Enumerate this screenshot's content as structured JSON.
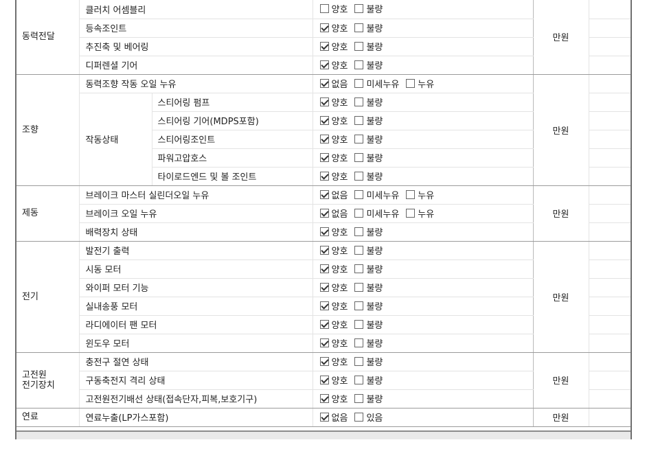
{
  "price_unit": "만원",
  "sections": [
    {
      "category": "동력전달",
      "price": "만원",
      "rows": [
        {
          "item": "클러치 어셈블리",
          "options": [
            {
              "label": "양호",
              "checked": false
            },
            {
              "label": "불량",
              "checked": false
            }
          ]
        },
        {
          "item": "등속조인트",
          "options": [
            {
              "label": "양호",
              "checked": true
            },
            {
              "label": "불량",
              "checked": false
            }
          ]
        },
        {
          "item": "추진축 및 베어링",
          "options": [
            {
              "label": "양호",
              "checked": true
            },
            {
              "label": "불량",
              "checked": false
            }
          ]
        },
        {
          "item": "디퍼렌셜 기어",
          "options": [
            {
              "label": "양호",
              "checked": true
            },
            {
              "label": "불량",
              "checked": false
            }
          ]
        }
      ]
    },
    {
      "category": "조향",
      "price": "만원",
      "rows": [
        {
          "item": "동력조향 작동 오일 누유",
          "options": [
            {
              "label": "없음",
              "checked": true
            },
            {
              "label": "미세누유",
              "checked": false
            },
            {
              "label": "누유",
              "checked": false
            }
          ]
        },
        {
          "item": "작동상태",
          "sub": "스티어링 펌프",
          "options": [
            {
              "label": "양호",
              "checked": true
            },
            {
              "label": "불량",
              "checked": false
            }
          ]
        },
        {
          "item": "작동상태",
          "sub": "스티어링 기어(MDPS포함)",
          "options": [
            {
              "label": "양호",
              "checked": true
            },
            {
              "label": "불량",
              "checked": false
            }
          ]
        },
        {
          "item": "작동상태",
          "sub": "스티어링조인트",
          "options": [
            {
              "label": "양호",
              "checked": true
            },
            {
              "label": "불량",
              "checked": false
            }
          ]
        },
        {
          "item": "작동상태",
          "sub": "파워고압호스",
          "options": [
            {
              "label": "양호",
              "checked": true
            },
            {
              "label": "불량",
              "checked": false
            }
          ]
        },
        {
          "item": "작동상태",
          "sub": "타이로드엔드 및 볼 조인트",
          "options": [
            {
              "label": "양호",
              "checked": true
            },
            {
              "label": "불량",
              "checked": false
            }
          ]
        }
      ]
    },
    {
      "category": "제동",
      "price": "만원",
      "rows": [
        {
          "item": "브레이크 마스터 실린더오일 누유",
          "options": [
            {
              "label": "없음",
              "checked": true
            },
            {
              "label": "미세누유",
              "checked": false
            },
            {
              "label": "누유",
              "checked": false
            }
          ]
        },
        {
          "item": "브레이크 오일 누유",
          "options": [
            {
              "label": "없음",
              "checked": true
            },
            {
              "label": "미세누유",
              "checked": false
            },
            {
              "label": "누유",
              "checked": false
            }
          ]
        },
        {
          "item": "배력장치 상태",
          "options": [
            {
              "label": "양호",
              "checked": true
            },
            {
              "label": "불량",
              "checked": false
            }
          ]
        }
      ]
    },
    {
      "category": "전기",
      "price": "만원",
      "rows": [
        {
          "item": "발전기 출력",
          "options": [
            {
              "label": "양호",
              "checked": true
            },
            {
              "label": "불량",
              "checked": false
            }
          ]
        },
        {
          "item": "시동 모터",
          "options": [
            {
              "label": "양호",
              "checked": true
            },
            {
              "label": "불량",
              "checked": false
            }
          ]
        },
        {
          "item": "와이퍼 모터 기능",
          "options": [
            {
              "label": "양호",
              "checked": true
            },
            {
              "label": "불량",
              "checked": false
            }
          ]
        },
        {
          "item": "실내송풍 모터",
          "options": [
            {
              "label": "양호",
              "checked": true
            },
            {
              "label": "불량",
              "checked": false
            }
          ]
        },
        {
          "item": "라디에이터 팬 모터",
          "options": [
            {
              "label": "양호",
              "checked": true
            },
            {
              "label": "불량",
              "checked": false
            }
          ]
        },
        {
          "item": "윈도우 모터",
          "options": [
            {
              "label": "양호",
              "checked": true
            },
            {
              "label": "불량",
              "checked": false
            }
          ]
        }
      ]
    },
    {
      "category": "고전원\n전기장치",
      "price": "만원",
      "rows": [
        {
          "item": "충전구 절연 상태",
          "options": [
            {
              "label": "양호",
              "checked": true
            },
            {
              "label": "불량",
              "checked": false
            }
          ]
        },
        {
          "item": "구동축전지 격리 상태",
          "options": [
            {
              "label": "양호",
              "checked": true
            },
            {
              "label": "불량",
              "checked": false
            }
          ]
        },
        {
          "item": "고전원전기배선 상태(접속단자,피복,보호기구)",
          "options": [
            {
              "label": "양호",
              "checked": true
            },
            {
              "label": "불량",
              "checked": false
            }
          ]
        }
      ]
    },
    {
      "category": "연료",
      "price": "만원",
      "rows": [
        {
          "item": "연료누출(LP가스포함)",
          "options": [
            {
              "label": "없음",
              "checked": true
            },
            {
              "label": "있음",
              "checked": false
            }
          ]
        }
      ]
    }
  ]
}
